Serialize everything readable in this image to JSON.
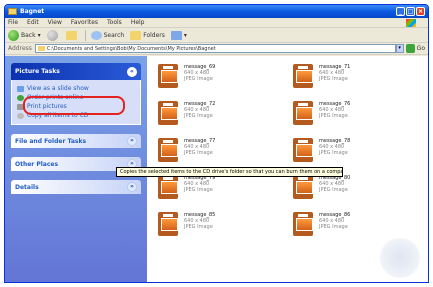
{
  "window": {
    "title": "Bagnet"
  },
  "menu": [
    "File",
    "Edit",
    "View",
    "Favorites",
    "Tools",
    "Help"
  ],
  "toolbar": {
    "back": "Back",
    "search": "Search",
    "folders": "Folders"
  },
  "address": {
    "label": "Address",
    "path": "C:\\Documents and Settings\\Bob\\My Documents\\My Pictures\\Bagnet",
    "go": "Go"
  },
  "taskpane": {
    "picture_tasks": {
      "title": "Picture Tasks",
      "items": [
        "View as a slide show",
        "Order prints online",
        "Print pictures",
        "Copy all items to CD"
      ]
    },
    "sections": [
      "File and Folder Tasks",
      "Other Places",
      "Details"
    ]
  },
  "files": [
    {
      "name": "message_69",
      "dims": "640 x 480",
      "type": "JPEG Image"
    },
    {
      "name": "message_71",
      "dims": "640 x 480",
      "type": "JPEG Image"
    },
    {
      "name": "message_72",
      "dims": "640 x 480",
      "type": "JPEG Image"
    },
    {
      "name": "message_76",
      "dims": "640 x 480",
      "type": "JPEG Image"
    },
    {
      "name": "message_77",
      "dims": "640 x 480",
      "type": "JPEG Image"
    },
    {
      "name": "message_78",
      "dims": "640 x 480",
      "type": "JPEG Image"
    },
    {
      "name": "message_79",
      "dims": "640 x 480",
      "type": "JPEG Image"
    },
    {
      "name": "message_80",
      "dims": "640 x 480",
      "type": "JPEG Image"
    },
    {
      "name": "message_85",
      "dims": "640 x 480",
      "type": "JPEG Image"
    },
    {
      "name": "message_86",
      "dims": "640 x 480",
      "type": "JPEG Image"
    }
  ],
  "tooltip": "Copies the selected items to the CD drive's folder so that you can burn them on a compact disc."
}
